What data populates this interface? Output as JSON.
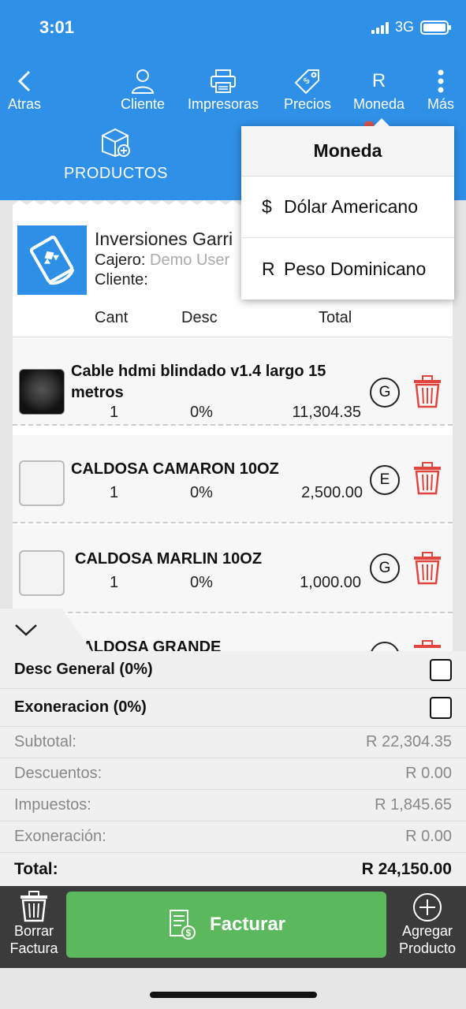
{
  "status": {
    "time": "3:01",
    "network": "3G"
  },
  "nav": {
    "back": "Atras",
    "cliente": "Cliente",
    "impresoras": "Impresoras",
    "precios": "Precios",
    "moneda_symbol": "R",
    "moneda": "Moneda",
    "mas": "Más"
  },
  "tab": {
    "label": "PRODUCTOS"
  },
  "receipt": {
    "business_name": "Inversiones Garri",
    "cajero_label": "Cajero:",
    "cajero_value": "Demo User",
    "cliente_label": "Cliente:",
    "columns": {
      "cant": "Cant",
      "desc": "Desc",
      "total": "Total"
    },
    "items": [
      {
        "name": "Cable hdmi blindado v1.4 largo 15 metros",
        "qty": "1",
        "discount": "0%",
        "total": "11,304.35",
        "tax": "G",
        "thumb": "photo"
      },
      {
        "name": "CALDOSA CAMARON 10OZ",
        "qty": "1",
        "discount": "0%",
        "total": "2,500.00",
        "tax": "E",
        "thumb": "box"
      },
      {
        "name": "CALDOSA MARLIN 10OZ",
        "qty": "1",
        "discount": "0%",
        "total": "1,000.00",
        "tax": "G",
        "thumb": "box"
      },
      {
        "name": "CALDOSA GRANDE",
        "qty": "",
        "discount": "",
        "total": "",
        "tax": "",
        "thumb": "box"
      }
    ]
  },
  "summary": {
    "desc_general": "Desc General (0%)",
    "exoneracion": "Exoneracion (0%)",
    "rows": [
      {
        "label": "Subtotal:",
        "value": "R 22,304.35"
      },
      {
        "label": "Descuentos:",
        "value": "R 0.00"
      },
      {
        "label": "Impuestos:",
        "value": "R 1,845.65"
      },
      {
        "label": "Exoneración:",
        "value": "R 0.00"
      }
    ],
    "total_label": "Total:",
    "total_value": "R 24,150.00"
  },
  "bottom": {
    "borrar_1": "Borrar",
    "borrar_2": "Factura",
    "facturar": "Facturar",
    "agregar_1": "Agregar",
    "agregar_2": "Producto"
  },
  "dropdown": {
    "title": "Moneda",
    "options": [
      {
        "symbol": "$",
        "label": "Dólar Americano"
      },
      {
        "symbol": "R",
        "label": "Peso Dominicano"
      }
    ]
  },
  "colors": {
    "primary": "#2f90e8",
    "success": "#5cb85c",
    "danger": "#e0463f",
    "dark_bar": "#3b3b3b"
  }
}
